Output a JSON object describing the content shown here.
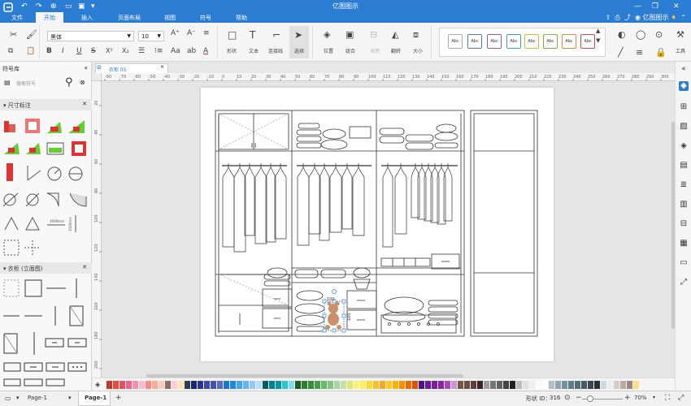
{
  "app": {
    "title": "亿图图示",
    "user": "亿图图示"
  },
  "menu": {
    "tabs": [
      "文件",
      "开始",
      "插入",
      "页面布局",
      "视图",
      "符号",
      "帮助"
    ],
    "active": "开始"
  },
  "ribbon": {
    "font": "黑体",
    "size": "10",
    "tools": [
      "形状",
      "文本",
      "连接线",
      "选择"
    ],
    "arrange": [
      "位置",
      "组合",
      "对齐",
      "翻转",
      "大小"
    ],
    "tools_label": "工具",
    "style_sample": "Abc"
  },
  "left_panel": {
    "title": "符号库",
    "search_placeholder": "搜索符号",
    "sections": [
      "尺寸标注",
      "衣柜 (立面图)"
    ],
    "dim_label": "1000mm"
  },
  "document": {
    "tab": "衣柜 05"
  },
  "ruler": {
    "h": [
      "-80",
      "-70",
      "-60",
      "-50",
      "-40",
      "-30",
      "-20",
      "-10",
      "0",
      "10",
      "20",
      "30",
      "40",
      "50",
      "60",
      "70",
      "80",
      "90",
      "100",
      "110",
      "120",
      "130",
      "140",
      "150",
      "160",
      "170",
      "180",
      "190",
      "200",
      "210",
      "220",
      "230",
      "240",
      "250",
      "260",
      "270",
      "280",
      "290",
      "300"
    ],
    "v": [
      "20",
      "40",
      "60",
      "80",
      "100",
      "120",
      "140",
      "160",
      "180",
      "200"
    ]
  },
  "selection": {
    "w_label": "100",
    "h_label": "100"
  },
  "status": {
    "page_tab": "Page-1",
    "active_page": "Page-1",
    "add": "+",
    "shape_id_label": "形状 ID：",
    "shape_id": "316",
    "zoom": "70%"
  },
  "colors": {
    "accent": "#2b7cd3"
  }
}
